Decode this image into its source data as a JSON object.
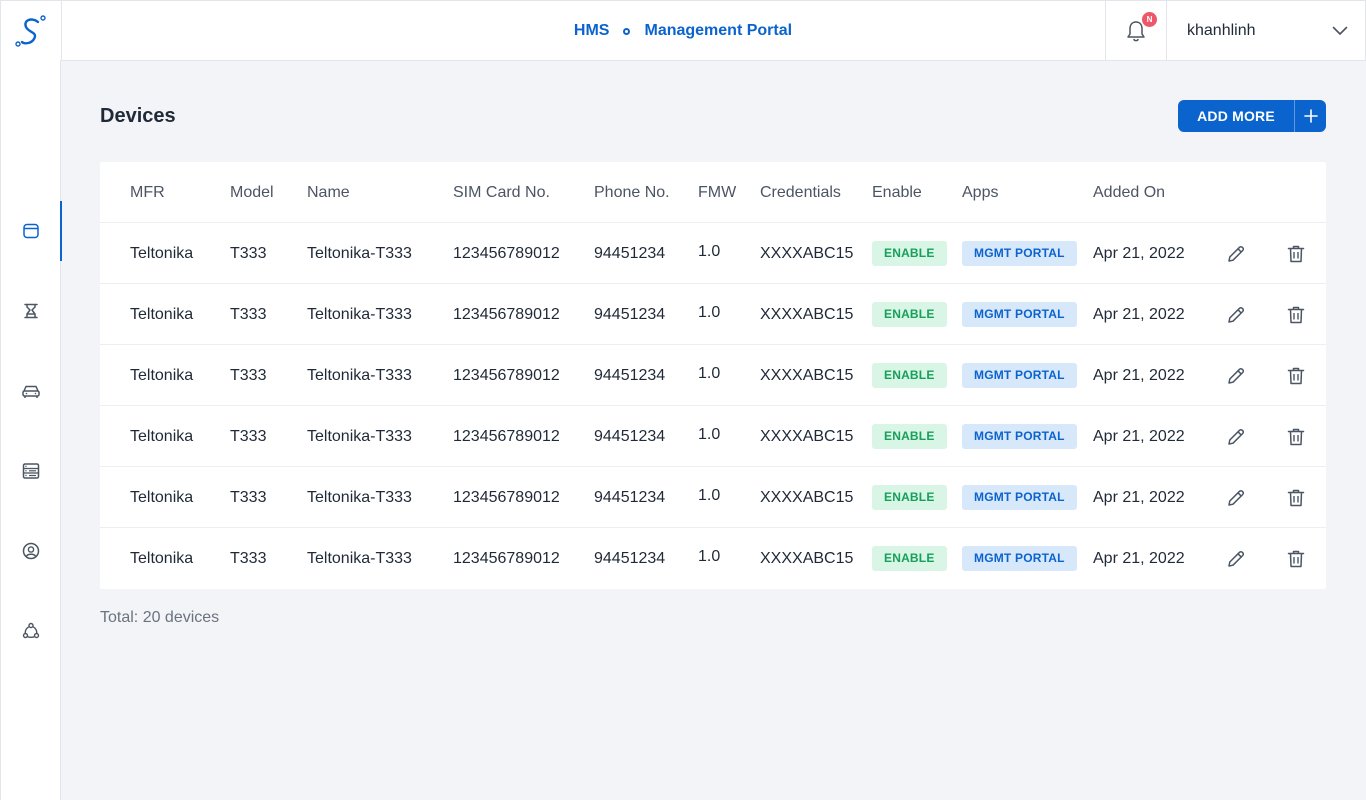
{
  "header": {
    "brand_primary": "HMS",
    "brand_secondary": "Management Portal",
    "notification_badge": "N",
    "username": "khanhlinh"
  },
  "sidebar": {
    "items": [
      {
        "icon": "browser-window-icon",
        "active": true
      },
      {
        "icon": "hourglass-icon",
        "active": false
      },
      {
        "icon": "car-icon",
        "active": false
      },
      {
        "icon": "server-list-icon",
        "active": false
      },
      {
        "icon": "user-circle-icon",
        "active": false
      },
      {
        "icon": "network-share-icon",
        "active": false
      }
    ]
  },
  "page": {
    "title": "Devices",
    "add_button_label": "ADD MORE",
    "total_text": "Total: 20 devices"
  },
  "table": {
    "columns": {
      "mfr": "MFR",
      "model": "Model",
      "name": "Name",
      "sim": "SIM Card No.",
      "phone": "Phone No.",
      "fmw": "FMW",
      "credentials": "Credentials",
      "enable": "Enable",
      "apps": "Apps",
      "added_on": "Added On"
    },
    "rows": [
      {
        "mfr": "Teltonika",
        "model": "T333",
        "name": "Teltonika-T333",
        "sim": "123456789012",
        "phone": "94451234",
        "fmw": "1.0",
        "credentials": "XXXXABC15",
        "enable": "ENABLE",
        "apps": "MGMT PORTAL",
        "added_on": "Apr 21, 2022"
      },
      {
        "mfr": "Teltonika",
        "model": "T333",
        "name": "Teltonika-T333",
        "sim": "123456789012",
        "phone": "94451234",
        "fmw": "1.0",
        "credentials": "XXXXABC15",
        "enable": "ENABLE",
        "apps": "MGMT PORTAL",
        "added_on": "Apr 21, 2022"
      },
      {
        "mfr": "Teltonika",
        "model": "T333",
        "name": "Teltonika-T333",
        "sim": "123456789012",
        "phone": "94451234",
        "fmw": "1.0",
        "credentials": "XXXXABC15",
        "enable": "ENABLE",
        "apps": "MGMT PORTAL",
        "added_on": "Apr 21, 2022"
      },
      {
        "mfr": "Teltonika",
        "model": "T333",
        "name": "Teltonika-T333",
        "sim": "123456789012",
        "phone": "94451234",
        "fmw": "1.0",
        "credentials": "XXXXABC15",
        "enable": "ENABLE",
        "apps": "MGMT PORTAL",
        "added_on": "Apr 21, 2022"
      },
      {
        "mfr": "Teltonika",
        "model": "T333",
        "name": "Teltonika-T333",
        "sim": "123456789012",
        "phone": "94451234",
        "fmw": "1.0",
        "credentials": "XXXXABC15",
        "enable": "ENABLE",
        "apps": "MGMT PORTAL",
        "added_on": "Apr 21, 2022"
      },
      {
        "mfr": "Teltonika",
        "model": "T333",
        "name": "Teltonika-T333",
        "sim": "123456789012",
        "phone": "94451234",
        "fmw": "1.0",
        "credentials": "XXXXABC15",
        "enable": "ENABLE",
        "apps": "MGMT PORTAL",
        "added_on": "Apr 21, 2022"
      }
    ]
  },
  "colors": {
    "accent": "#0b63ce",
    "enable_badge_bg": "#d8f5e6",
    "enable_badge_text": "#17a05a",
    "apps_badge_bg": "#d7e8fb",
    "notification": "#f0566a"
  }
}
